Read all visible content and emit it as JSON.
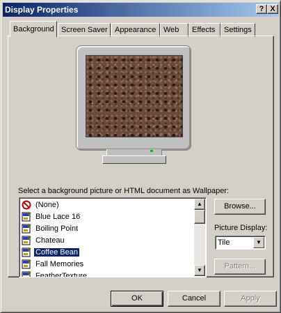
{
  "window": {
    "title": "Display Properties",
    "help_label": "?",
    "close_label": "X"
  },
  "tabs": [
    {
      "label": "Background",
      "active": true
    },
    {
      "label": "Screen Saver"
    },
    {
      "label": "Appearance"
    },
    {
      "label": "Web"
    },
    {
      "label": "Effects"
    },
    {
      "label": "Settings"
    }
  ],
  "wallpaper": {
    "prompt": "Select a background picture or HTML document as Wallpaper:",
    "items": [
      {
        "label": "(None)",
        "icon": "none-icon"
      },
      {
        "label": "Blue Lace 16",
        "icon": "bitmap-icon"
      },
      {
        "label": "Boiling Point",
        "icon": "bitmap-icon"
      },
      {
        "label": "Chateau",
        "icon": "bitmap-icon"
      },
      {
        "label": "Coffee Bean",
        "icon": "bitmap-icon",
        "selected": true
      },
      {
        "label": "Fall Memories",
        "icon": "bitmap-icon"
      },
      {
        "label": "FeatherTexture",
        "icon": "bitmap-icon"
      }
    ],
    "selected": "Coffee Bean"
  },
  "side": {
    "browse_label": "Browse...",
    "picture_display_label": "Picture Display:",
    "picture_display_value": "Tile",
    "pattern_label": "Pattern..."
  },
  "footer": {
    "ok_label": "OK",
    "cancel_label": "Cancel",
    "apply_label": "Apply"
  },
  "colors": {
    "title_start": "#0a246a",
    "title_end": "#a6caf0",
    "face": "#d4d0c8",
    "selection": "#0a246a"
  }
}
